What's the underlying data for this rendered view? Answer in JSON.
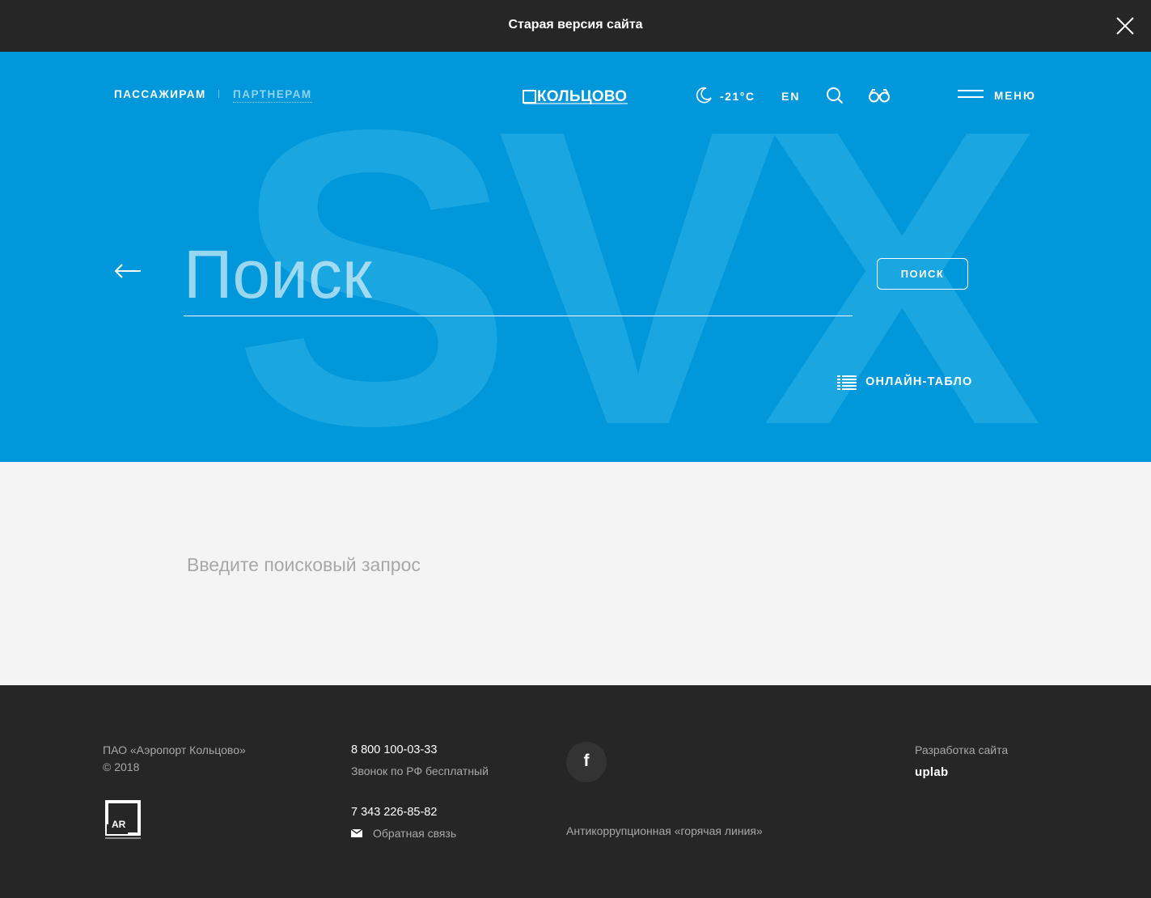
{
  "notice": {
    "text": "Старая версия сайта"
  },
  "header": {
    "nav": [
      {
        "label": "ПАССАЖИРАМ"
      },
      {
        "label": "ПАРТНЕРАМ"
      }
    ],
    "logo_text": "КОЛЬЦОВО",
    "weather": {
      "icon": "moon-icon",
      "temperature": "-21°C"
    },
    "lang": "EN",
    "menu_label": "МЕНЮ"
  },
  "hero": {
    "watermark": "SVX",
    "search": {
      "placeholder": "Поиск",
      "value": ""
    },
    "search_button": "ПОИСК",
    "tablo_label": "ОНЛАЙН-ТАБЛО"
  },
  "content": {
    "hint": "Введите поисковый запрос"
  },
  "footer": {
    "company": "ПАО «Аэропорт Кольцово»",
    "year": "© 2018",
    "ar_logo_text": "AR",
    "phone1": "8 800 100-03-33",
    "phone1_note": "Звонок по РФ бесплатный",
    "phone2": "7 343 226-85-82",
    "feedback": "Обратная связь",
    "facebook": "f",
    "hotline": "Антикоррупционная «горячая линия»",
    "dev_label": "Разработка сайта",
    "dev_name": "uplab"
  },
  "colors": {
    "hero_bg": "#0098da",
    "dark_bg": "#262626",
    "content_bg": "#f4f4f4"
  }
}
